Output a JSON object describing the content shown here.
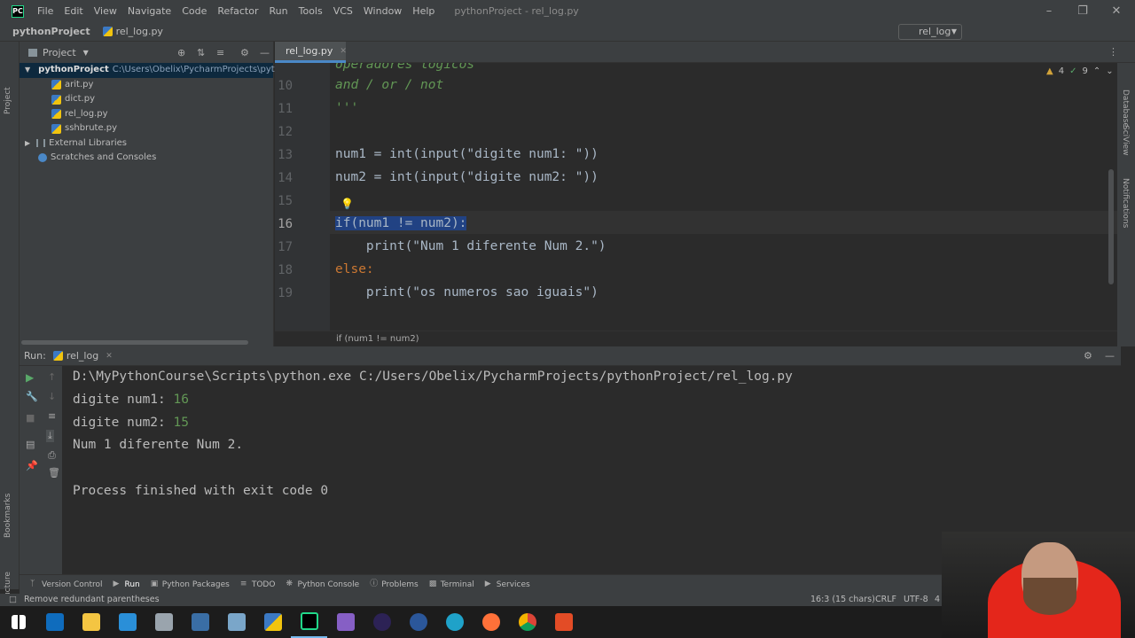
{
  "menubar": {
    "items": [
      "File",
      "Edit",
      "View",
      "Navigate",
      "Code",
      "Refactor",
      "Run",
      "Tools",
      "VCS",
      "Window",
      "Help"
    ],
    "window_title": "pythonProject - rel_log.py"
  },
  "navbar": {
    "project": "pythonProject",
    "file": "rel_log.py",
    "run_config": "rel_log"
  },
  "project_panel": {
    "title": "Project",
    "root": "pythonProject",
    "root_path": "C:\\Users\\Obelix\\PycharmProjects\\pythonP",
    "files": [
      "arit.py",
      "dict.py",
      "rel_log.py",
      "sshbrute.py"
    ],
    "external": "External Libraries",
    "scratches": "Scratches and Consoles"
  },
  "editor": {
    "tab": "rel_log.py",
    "inspection_warnings": "4",
    "inspection_weak": "9",
    "lines": [
      {
        "n": "10",
        "t": "and / or / not"
      },
      {
        "n": "11",
        "t": "'''"
      },
      {
        "n": "12",
        "t": ""
      },
      {
        "n": "13",
        "t": "num1 = int(input(\"digite num1: \"))"
      },
      {
        "n": "14",
        "t": "num2 = int(input(\"digite num2: \"))"
      },
      {
        "n": "15",
        "t": ""
      },
      {
        "n": "16",
        "t": "if(num1 != num2):"
      },
      {
        "n": "17",
        "t": "    print(\"Num 1 diferente Num 2.\")"
      },
      {
        "n": "18",
        "t": "else:"
      },
      {
        "n": "19",
        "t": "    print(\"os numeros sao iguais\")"
      }
    ],
    "partial_top": "operadores logicos",
    "breadcrumb": "if (num1 != num2)"
  },
  "run": {
    "label": "Run:",
    "tab": "rel_log",
    "command": "D:\\MyPythonCourse\\Scripts\\python.exe C:/Users/Obelix/PycharmProjects/pythonProject/rel_log.py",
    "prompt1": "digite num1: ",
    "input1": "16",
    "prompt2": "digite num2: ",
    "input2": "15",
    "result": "Num 1 diferente Num 2.",
    "exit": "Process finished with exit code 0"
  },
  "toolwindows": [
    "Version Control",
    "Run",
    "Python Packages",
    "TODO",
    "Python Console",
    "Problems",
    "Terminal",
    "Services"
  ],
  "status": {
    "message": "Remove redundant parentheses",
    "position": "16:3 (15 chars)",
    "line_sep": "CRLF",
    "encoding": "UTF-8",
    "indent": "4"
  },
  "side_labels": {
    "left": [
      "Project",
      "Bookmarks",
      "Structure"
    ],
    "right": [
      "Database",
      "SciView",
      "Notifications"
    ]
  }
}
